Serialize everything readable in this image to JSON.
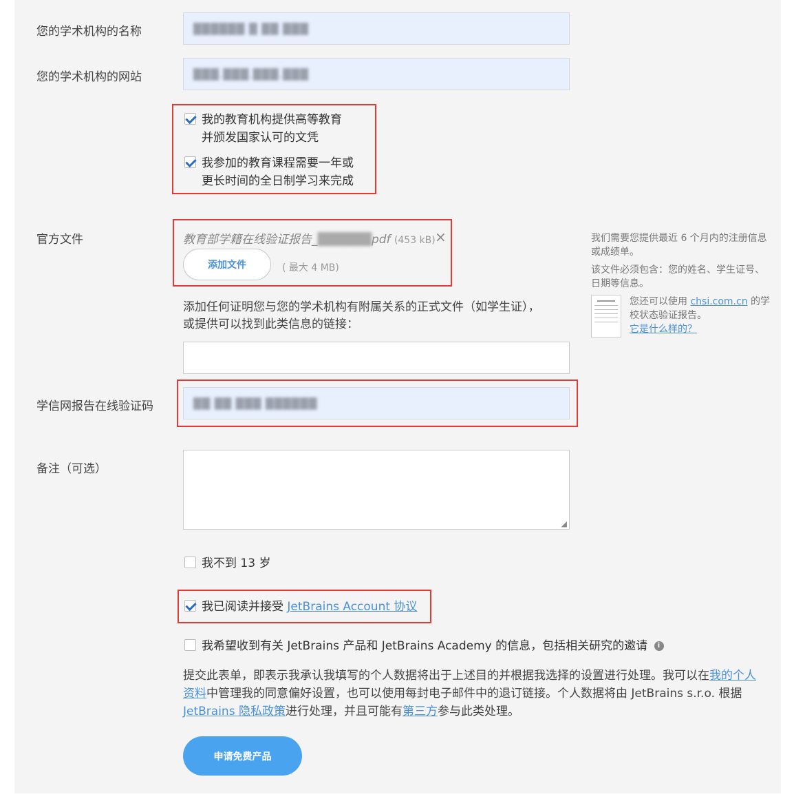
{
  "form": {
    "institution_name_label": "您的学术机构的名称",
    "institution_name_value": "██████ █ ██ ███",
    "institution_site_label": "您的学术机构的网站",
    "institution_site_value": "███.███.███.███",
    "check_higher_edu_line1": "我的教育机构提供高等教育",
    "check_higher_edu_line2": "并颁发国家认可的文凭",
    "check_fulltime_line1": "我参加的教育课程需要一年或",
    "check_fulltime_line2": "更长时间的全日制学习来完成",
    "official_docs_label": "官方文件",
    "file_name": "教育部学籍在线验证报告_",
    "file_name_blur": "██████",
    "file_ext": "pdf",
    "file_size": "(453 kB)",
    "remove_file": "×",
    "add_file_button": "添加文件",
    "max_size": "( 最大 4 MB)",
    "docs_hint": "添加任何证明您与您的学术机构有附属关系的正式文件（如学生证），或提供可以找到此类信息的链接：",
    "docs_link_value": "",
    "chsi_code_label": "学信网报告在线验证码",
    "chsi_code_value": "██ ██ ███ ██████",
    "notes_label": "备注（可选）",
    "notes_value": "",
    "under13_label": "我不到 13 岁",
    "agree_prefix": "我已阅读并接受 ",
    "agree_link": "JetBrains Account 协议",
    "newsletter_label": "我希望收到有关 JetBrains 产品和 JetBrains Academy 的信息，包括相关研究的邀请",
    "privacy_part1": "提交此表单，即表示我承认我填写的个人数据将出于上述目的并根据我选择的设置进行处理。我可以在",
    "privacy_link1": "我的个人资料",
    "privacy_part2": "中管理我的同意偏好设置，也可以使用每封电子邮件中的退订链接。个人数据将由 JetBrains s.r.o. 根据 ",
    "privacy_link2": "JetBrains 隐私政策",
    "privacy_part3": "进行处理，并且可能有",
    "privacy_link3": "第三方",
    "privacy_part4": "参与此类处理。",
    "submit_button": "申请免费产品"
  },
  "sidebar_note": {
    "line1": "我们需要您提供最近 6 个月内的注册信息或成绩单。",
    "line2": "该文件必须包含：您的姓名、学生证号、日期等信息。",
    "chsi_prefix": "您还可以使用 ",
    "chsi_link": "chsi.com.cn",
    "chsi_suffix": " 的学校状态验证报告。",
    "example_link": "它是什么样的？"
  },
  "colors": {
    "accent": "#4a90d9",
    "highlight_box": "#e53935",
    "autofill_bg": "#e8f0fe"
  }
}
